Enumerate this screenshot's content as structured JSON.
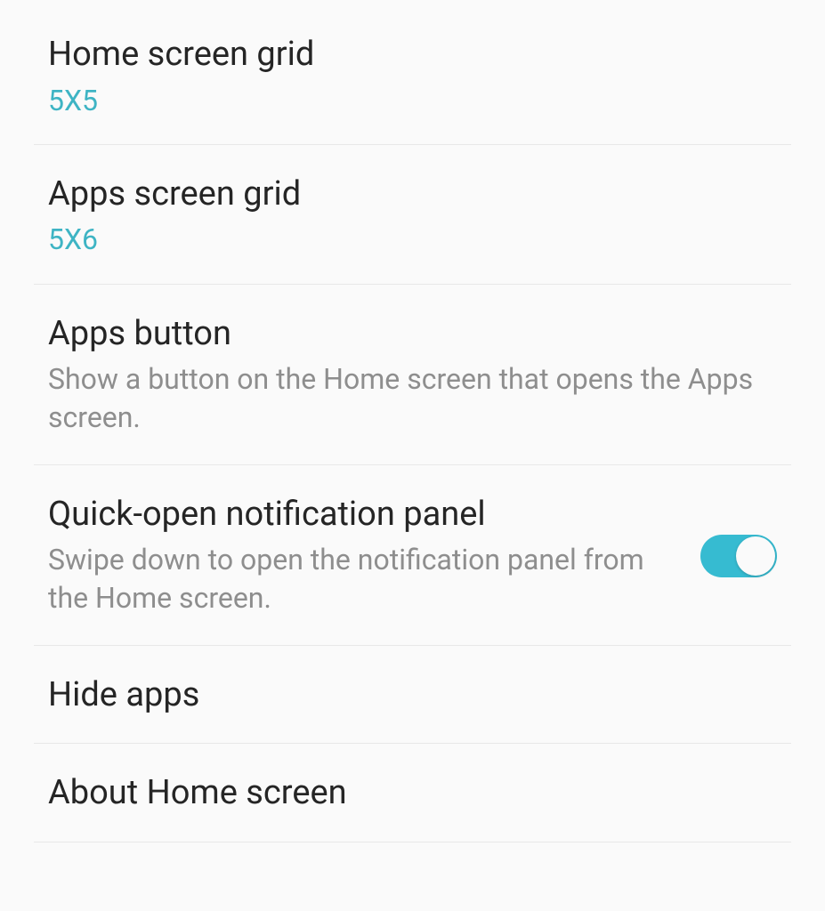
{
  "settings": {
    "home_grid": {
      "title": "Home screen grid",
      "value": "5X5"
    },
    "apps_grid": {
      "title": "Apps screen grid",
      "value": "5X6"
    },
    "apps_button": {
      "title": "Apps button",
      "description": "Show a button on the Home screen that opens the Apps screen."
    },
    "quick_open": {
      "title": "Quick-open notification panel",
      "description": "Swipe down to open the notification panel from the Home screen."
    },
    "hide_apps": {
      "title": "Hide apps"
    },
    "about": {
      "title": "About Home screen"
    }
  }
}
